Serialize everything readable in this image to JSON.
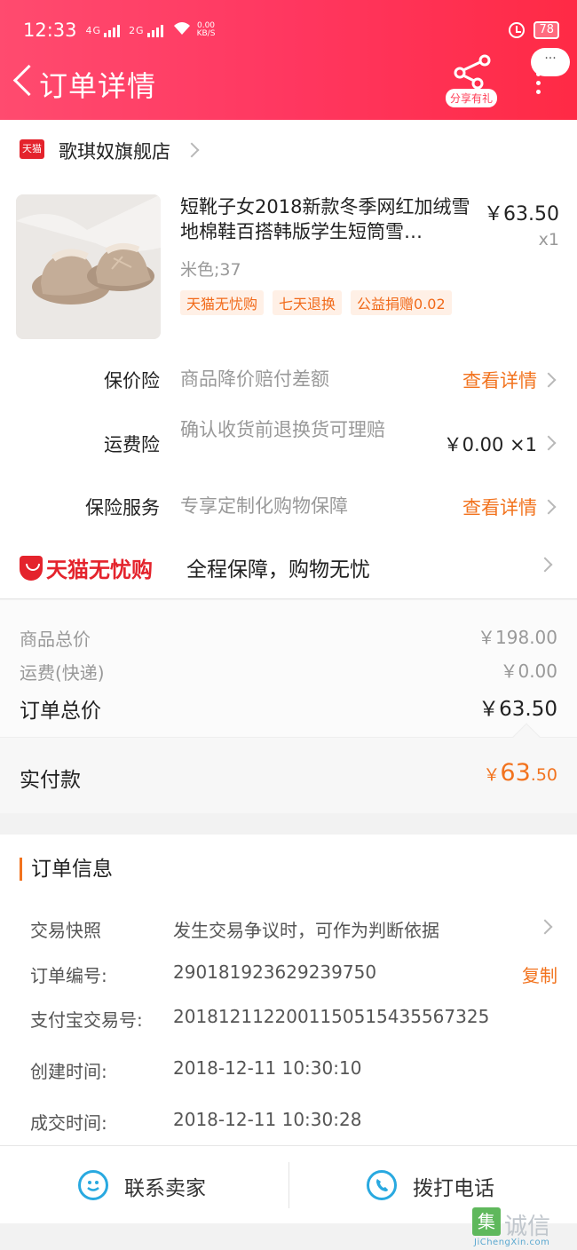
{
  "status_bar": {
    "time": "12:33",
    "net1": "4G",
    "net2": "2G",
    "speed_value": "0.00",
    "speed_unit": "KB/S",
    "battery": "78"
  },
  "header": {
    "title": "订单详情",
    "share_label": "分享有礼",
    "more_bubble": "···"
  },
  "store": {
    "badge": "天猫",
    "name": "歌琪奴旗舰店"
  },
  "product": {
    "title": "短靴子女2018新款冬季网红加绒雪地棉鞋百搭韩版学生短筒雪…",
    "price": "￥63.50",
    "quantity": "x1",
    "sku": "米色;37",
    "tags": [
      "天猫无忧购",
      "七天退换",
      "公益捐赠0.02"
    ]
  },
  "services": [
    {
      "label": "保价险",
      "desc": "商品降价赔付差额",
      "action": "查看详情"
    },
    {
      "label": "运费险",
      "desc": "确认收货前退换货可理赔",
      "value": "￥0.00 ×1"
    },
    {
      "label": "保险服务",
      "desc": "专享定制化购物保障",
      "action": "查看详情"
    }
  ],
  "worry_free": {
    "brand": "天猫无忧购",
    "text": "全程保障，购物无忧"
  },
  "prices": {
    "goods_total_label": "商品总价",
    "goods_total": "￥198.00",
    "shipping_label": "运费(快递)",
    "shipping": "￥0.00",
    "order_total_label": "订单总价",
    "order_total": "￥63.50"
  },
  "paid": {
    "label": "实付款",
    "currency": "￥",
    "integer": "63",
    "decimal": ".50"
  },
  "order_info": {
    "title": "订单信息",
    "snapshot_label": "交易快照",
    "snapshot_desc": "发生交易争议时，可作为判断依据",
    "order_no_label": "订单编号:",
    "order_no": "290181923629239750",
    "copy_label": "复制",
    "alipay_label": "支付宝交易号:",
    "alipay_no": "2018121122001150515435567325",
    "created_label": "创建时间:",
    "created": "2018-12-11 10:30:10",
    "deal_label": "成交时间:",
    "deal": "2018-12-11 10:30:28"
  },
  "actions": {
    "contact_seller": "联系卖家",
    "call_phone": "拨打电话"
  },
  "watermark": {
    "brand": "诚信",
    "box": "集",
    "url": "JiChengXin.com"
  },
  "colors": {
    "header_start": "#ff4b6f",
    "header_end": "#ff2a45",
    "accent_orange": "#f2731e",
    "tmall_red": "#e4232c",
    "icon_blue": "#29a9e0"
  }
}
